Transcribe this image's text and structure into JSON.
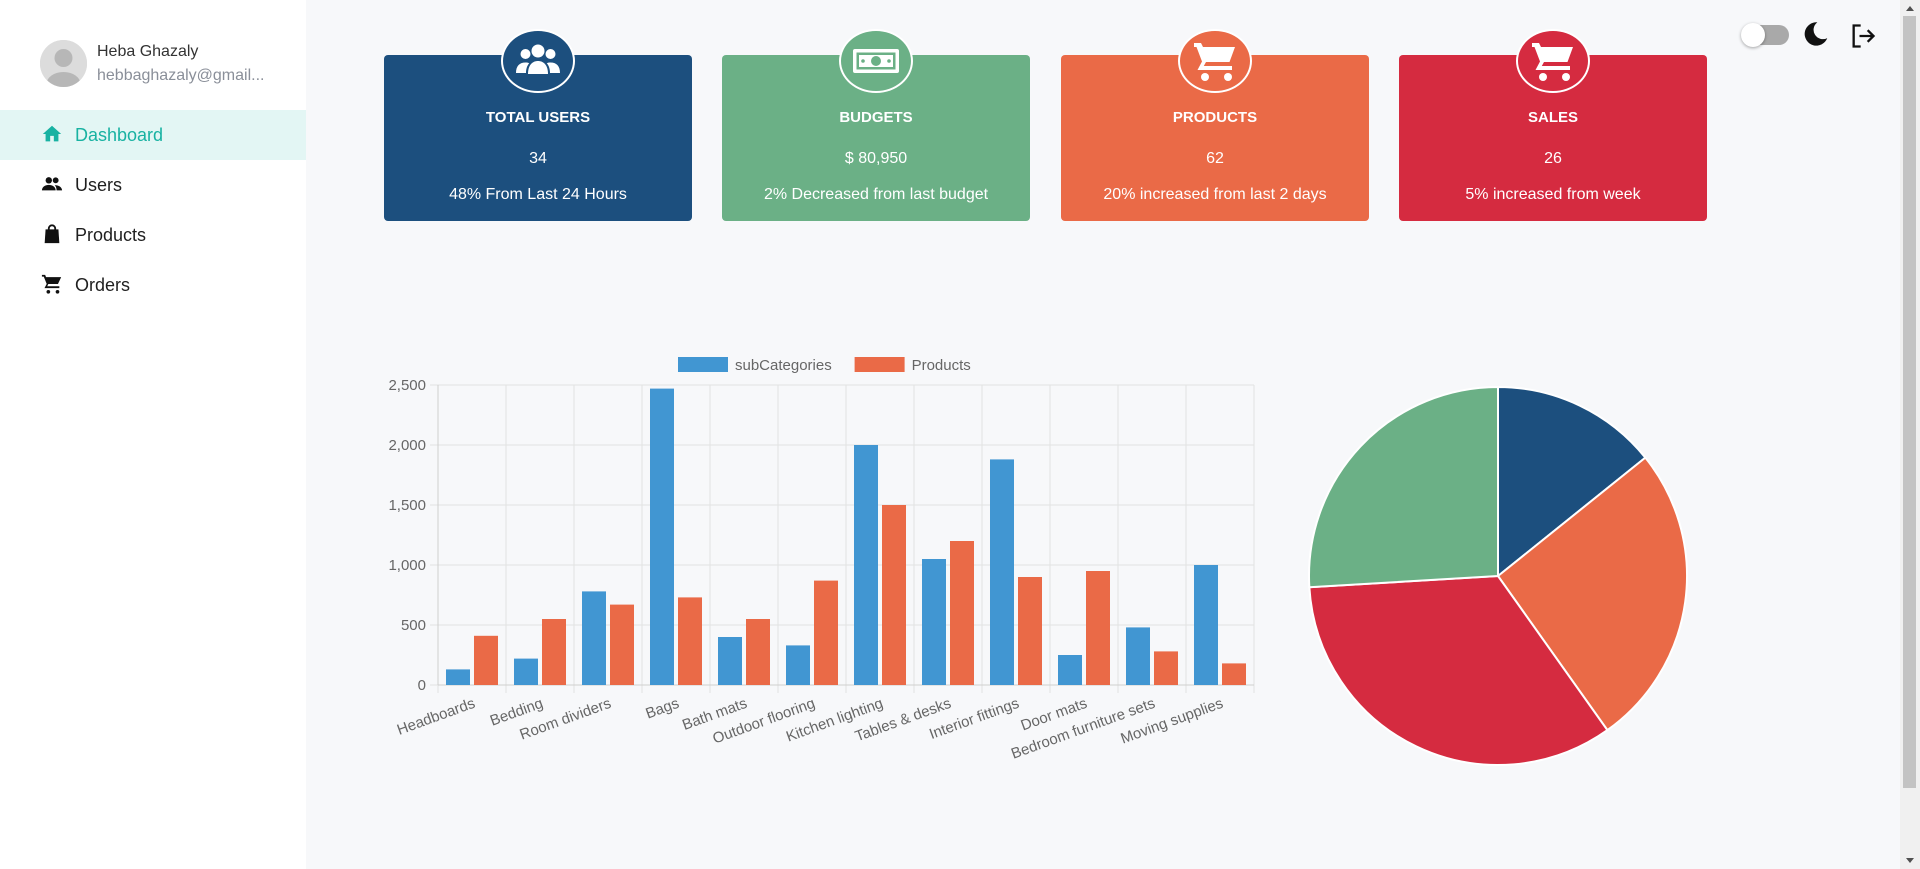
{
  "profile": {
    "name": "Heba Ghazaly",
    "email": "hebbaghazaly@gmail..."
  },
  "nav": {
    "items": [
      {
        "label": "Dashboard",
        "icon": "home-icon",
        "active": true
      },
      {
        "label": "Users",
        "icon": "users-icon",
        "active": false
      },
      {
        "label": "Products",
        "icon": "shopping-bag-icon",
        "active": false
      },
      {
        "label": "Orders",
        "icon": "cart-icon",
        "active": false
      }
    ]
  },
  "header": {
    "theme_toggle_icon": "moon-icon",
    "logout_icon": "logout-icon"
  },
  "stats": [
    {
      "title": "TOTAL USERS",
      "value": "34",
      "subtitle": "48% From Last 24 Hours",
      "color": "#1c4f7e",
      "icon": "users-icon"
    },
    {
      "title": "BUDGETS",
      "value": "$ 80,950",
      "subtitle": "2% Decreased from last budget",
      "color": "#6bb086",
      "icon": "money-icon"
    },
    {
      "title": "PRODUCTS",
      "value": "62",
      "subtitle": "20% increased from last 2 days",
      "color": "#ea6a47",
      "icon": "cart-icon"
    },
    {
      "title": "SALES",
      "value": "26",
      "subtitle": "5% increased from week",
      "color": "#d52b40",
      "icon": "cart-icon"
    }
  ],
  "chart_data": [
    {
      "type": "bar",
      "categories": [
        "Headboards",
        "Bedding",
        "Room dividers",
        "Bags",
        "Bath mats",
        "Outdoor flooring",
        "Kitchen lighting",
        "Tables & desks",
        "Interior fittings",
        "Door mats",
        "Bedroom furniture sets",
        "Moving supplies"
      ],
      "series": [
        {
          "name": "subCategories",
          "color": "#4196d2",
          "values": [
            130,
            220,
            780,
            2470,
            400,
            330,
            2000,
            1050,
            1880,
            250,
            480,
            1000
          ]
        },
        {
          "name": "Products",
          "color": "#ea6a47",
          "values": [
            410,
            550,
            670,
            730,
            550,
            870,
            1500,
            1200,
            900,
            950,
            280,
            180
          ]
        }
      ],
      "y_ticks": [
        "0",
        "500",
        "1,000",
        "1,500",
        "2,000",
        "2,500"
      ],
      "ylim": [
        0,
        2500
      ],
      "grid": true,
      "legend": "top"
    },
    {
      "type": "pie",
      "slices": [
        {
          "value": 34,
          "color": "#1c4f7e"
        },
        {
          "value": 62,
          "color": "#ea6a47"
        },
        {
          "value": 80.95,
          "color": "#d52b40"
        },
        {
          "value": 62,
          "color": "#6bb086"
        }
      ]
    }
  ]
}
